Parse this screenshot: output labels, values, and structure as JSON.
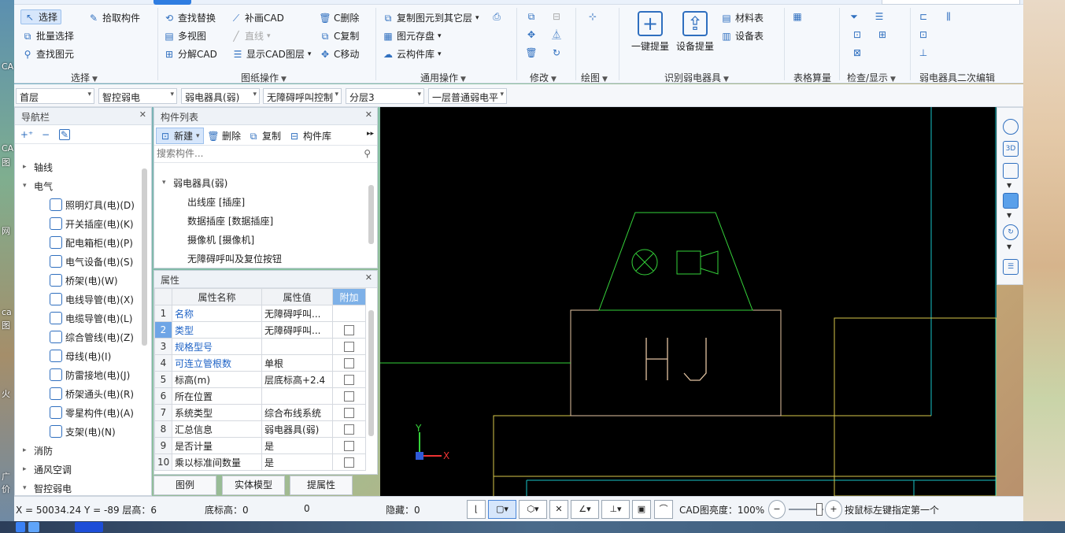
{
  "ribbon": {
    "select_group": {
      "select": "选择",
      "pick_component": "拾取构件",
      "batch_select": "批量选择",
      "find_element": "查找图元",
      "label": "选择"
    },
    "drawing_ops": {
      "find_replace": "查找替换",
      "supplement_cad": "补画CAD",
      "delete_c": "C删除",
      "multi_view": "多视图",
      "line": "直线",
      "copy_c": "C复制",
      "decompose_cad": "分解CAD",
      "show_cad_layer": "显示CAD图层",
      "move_c": "C移动",
      "label": "图纸操作"
    },
    "common_ops": {
      "copy_to_layer": "复制图元到其它层",
      "save_element": "图元存盘",
      "cloud_library": "云构件库",
      "label": "通用操作"
    },
    "modify": {
      "label": "修改"
    },
    "draw": {
      "label": "绘图"
    },
    "identify": {
      "one_click": "一键提量",
      "equipment": "设备提量",
      "material_table": "材料表",
      "equipment_table": "设备表",
      "label": "识别弱电器具"
    },
    "table_calc": {
      "label": "表格算量"
    },
    "check_display": {
      "label": "检查/显示"
    },
    "secondary_edit": {
      "label": "弱电器具二次编辑"
    }
  },
  "filters": [
    "首层",
    "智控弱电",
    "弱电器具(弱)",
    "无障碍呼叫控制",
    "分层3",
    "一层普通弱电平"
  ],
  "nav": {
    "title": "导航栏",
    "items": [
      {
        "label": "轴线",
        "level": 0,
        "expanded": false
      },
      {
        "label": "电气",
        "level": 0,
        "expanded": true
      },
      {
        "label": "照明灯具(电)(D)",
        "level": 1
      },
      {
        "label": "开关插座(电)(K)",
        "level": 1
      },
      {
        "label": "配电箱柜(电)(P)",
        "level": 1
      },
      {
        "label": "电气设备(电)(S)",
        "level": 1
      },
      {
        "label": "桥架(电)(W)",
        "level": 1
      },
      {
        "label": "电线导管(电)(X)",
        "level": 1
      },
      {
        "label": "电缆导管(电)(L)",
        "level": 1
      },
      {
        "label": "综合管线(电)(Z)",
        "level": 1
      },
      {
        "label": "母线(电)(I)",
        "level": 1
      },
      {
        "label": "防雷接地(电)(J)",
        "level": 1
      },
      {
        "label": "桥架通头(电)(R)",
        "level": 1
      },
      {
        "label": "零星构件(电)(A)",
        "level": 1
      },
      {
        "label": "支架(电)(N)",
        "level": 1
      },
      {
        "label": "消防",
        "level": 0,
        "expanded": false
      },
      {
        "label": "通风空调",
        "level": 0,
        "expanded": false
      },
      {
        "label": "智控弱电",
        "level": 0,
        "expanded": true
      }
    ]
  },
  "component_list": {
    "title": "构件列表",
    "new": "新建",
    "delete": "删除",
    "copy": "复制",
    "library": "构件库",
    "search_placeholder": "搜索构件...",
    "group": "弱电器具(弱)",
    "items": [
      "出线座 [插座]",
      "数据插座 [数据插座]",
      "摄像机 [摄像机]",
      "无障碍呼叫及复位按钮"
    ]
  },
  "properties": {
    "title": "属性",
    "headers": [
      "属性名称",
      "属性值",
      "附加"
    ],
    "rows": [
      {
        "n": "1",
        "name": "名称",
        "value": "无障碍呼叫...",
        "blue": true,
        "checkbox": false
      },
      {
        "n": "2",
        "name": "类型",
        "value": "无障碍呼叫...",
        "blue": true,
        "checkbox": true
      },
      {
        "n": "3",
        "name": "规格型号",
        "value": "",
        "blue": true,
        "checkbox": true
      },
      {
        "n": "4",
        "name": "可连立管根数",
        "value": "单根",
        "blue": true,
        "checkbox": true
      },
      {
        "n": "5",
        "name": "标高(m)",
        "value": "层底标高+2.4",
        "blue": false,
        "checkbox": true
      },
      {
        "n": "6",
        "name": "所在位置",
        "value": "",
        "blue": false,
        "checkbox": true
      },
      {
        "n": "7",
        "name": "系统类型",
        "value": "综合布线系统",
        "blue": false,
        "checkbox": true
      },
      {
        "n": "8",
        "name": "汇总信息",
        "value": "弱电器具(弱)",
        "blue": false,
        "checkbox": true
      },
      {
        "n": "9",
        "name": "是否计量",
        "value": "是",
        "blue": false,
        "checkbox": true
      },
      {
        "n": "10",
        "name": "乘以标准间数量",
        "value": "是",
        "blue": false,
        "checkbox": true
      }
    ],
    "buttons": [
      "图例",
      "实体模型",
      "提属性"
    ]
  },
  "canvas": {
    "text": "HJ",
    "axis_x": "X",
    "axis_y": "Y"
  },
  "status": {
    "coords": "X = 50034.24 Y = -89 层高：6",
    "bottom_elev": "底标高：0",
    "zero": "0",
    "hidden": "隐藏：0",
    "cad_brightness": "CAD图亮度：100%",
    "hint": "按鼠标左键指定第一个角"
  },
  "desktop": {
    "left_labels": [
      "CA",
      "CA",
      "图",
      "网",
      "ca",
      "图",
      "火",
      "广",
      "价"
    ]
  }
}
